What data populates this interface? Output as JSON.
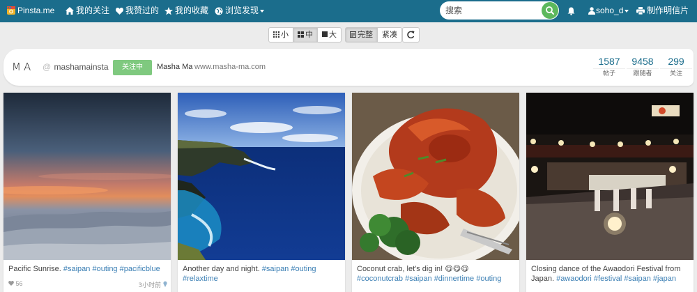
{
  "nav": {
    "brand": "Pinsta.me",
    "items": [
      {
        "label": "我的关注",
        "icon": "home-icon"
      },
      {
        "label": "我赞过的",
        "icon": "heart-icon"
      },
      {
        "label": "我的收藏",
        "icon": "star-icon"
      },
      {
        "label": "浏览发现",
        "icon": "globe-icon"
      }
    ],
    "search_placeholder": "搜索",
    "user": "soho_d",
    "print_label": "制作明信片"
  },
  "view_toolbar": {
    "sizes": [
      {
        "label": "小",
        "icon": "grid-small-icon",
        "active": false
      },
      {
        "label": "中",
        "icon": "grid-medium-icon",
        "active": true
      },
      {
        "label": "大",
        "icon": "square-icon",
        "active": false
      }
    ],
    "modes": [
      {
        "label": "完整",
        "icon": "list-icon",
        "active": true
      },
      {
        "label": "紧凑",
        "active": false
      }
    ]
  },
  "profile": {
    "logo_text": "MA",
    "handle": "mashamainsta",
    "follow_status": "关注中",
    "name": "Masha Ma",
    "website": "www.masha-ma.com",
    "stats": [
      {
        "value": "1587",
        "label": "帖子"
      },
      {
        "value": "9458",
        "label": "跟随者"
      },
      {
        "value": "299",
        "label": "关注"
      }
    ]
  },
  "posts": [
    {
      "caption": "Pacific Sunrise.",
      "tags": "#saipan #outing #pacificblue",
      "likes": "56",
      "time": "3小时前"
    },
    {
      "caption": "Another day and night.",
      "tags": "#saipan #outing #relaxtime",
      "likes": "",
      "time": ""
    },
    {
      "caption": "Coconut crab, let's dig in! 😋😋😋",
      "tags": "#coconutcrab #saipan #dinnertime #outing",
      "likes": "",
      "time": ""
    },
    {
      "caption": "Closing dance of the Awaodori Festival from Japan.",
      "tags": "#awaodori #festival #saipan #japan",
      "likes": "",
      "time": ""
    }
  ],
  "colors": {
    "navbar": "#1b6d8c",
    "accent_link": "#3b7fb4",
    "follow_button": "#7fc97f",
    "search_button": "#5cb85c"
  }
}
